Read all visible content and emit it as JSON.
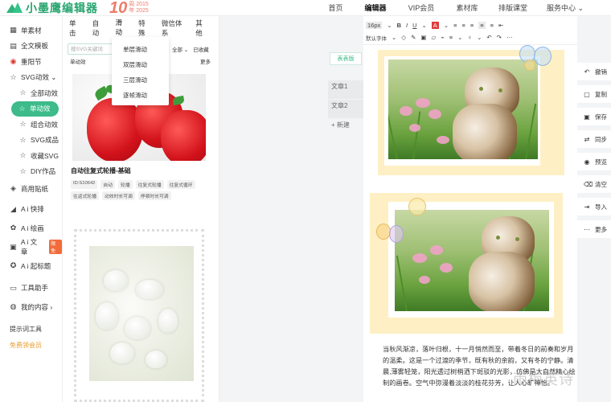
{
  "brand": {
    "name": "小墨鹰编辑器",
    "badge_num": "10",
    "badge_line1": "周 2015",
    "badge_line2": "年 2025"
  },
  "nav": [
    "首页",
    "编辑器",
    "VIP会员",
    "素材库",
    "排版课堂",
    "服务中心 ⌄"
  ],
  "sidebar": {
    "items": [
      {
        "icon": "grid-icon",
        "glyph": "▦",
        "label": "单素材"
      },
      {
        "icon": "template-icon",
        "glyph": "▤",
        "label": "全文模板"
      },
      {
        "icon": "festival-icon",
        "glyph": "◉",
        "label": "重阳节"
      },
      {
        "icon": "svg-icon",
        "glyph": "☆",
        "label": "SVG动效 ⌄"
      }
    ],
    "sub_items": [
      "全部动效",
      "单动效",
      "组合动效",
      "SVG成品",
      "收藏SVG",
      "DIY作品"
    ],
    "items2": [
      {
        "icon": "chart-icon",
        "glyph": "◈",
        "label": "商用贴纸"
      },
      {
        "icon": "ai-typeset-icon",
        "glyph": "◢",
        "label": "A i 快排"
      },
      {
        "icon": "ai-paint-icon",
        "glyph": "✿",
        "label": "A i 绘画"
      },
      {
        "icon": "ai-text-icon",
        "glyph": "▣",
        "label": "A i 文章",
        "hot": "限免"
      },
      {
        "icon": "ai-title-icon",
        "glyph": "✪",
        "label": "A i 起标题"
      },
      {
        "icon": "tool-icon",
        "glyph": "▭",
        "label": "工具助手"
      },
      {
        "icon": "user-icon",
        "glyph": "◍",
        "label": "我的内容 ›"
      }
    ],
    "footer": [
      "提示词工具",
      "免费领会员"
    ]
  },
  "panel": {
    "tabs": [
      "单击",
      "自动",
      "滑动",
      "特殊",
      "微信体系",
      "其他"
    ],
    "search_placeholder": "搜SVG关键词",
    "filter_all": "全部 ⌄",
    "filter_fav": "已收藏",
    "section_label": "单动效",
    "more": "更多",
    "item_title": "自动往复式轮播-基础",
    "tags": [
      "ID:S10642",
      "自动",
      "轮播",
      "往复式轮播",
      "往复式循环",
      "往返式轮播",
      "动效时长可调",
      "停顿时长可调"
    ]
  },
  "dropdown": [
    "单层滑动",
    "双层滑动",
    "三层滑动",
    "逐帧滑动"
  ],
  "canvas": {
    "style_button": "表表版",
    "docs": [
      "文章1",
      "文章2",
      "+ 新建"
    ],
    "toolbar_row1": [
      "16px",
      "⌄",
      "B",
      "I",
      "U",
      "⌄",
      "A",
      "⌄",
      "≡",
      "≡",
      "≡",
      "≡",
      "≡",
      "⇤"
    ],
    "toolbar_row2": [
      "默认字体",
      "⌄",
      "◇",
      "✎",
      "▣",
      "▱",
      "⌁",
      "≡",
      "⌄",
      "♀",
      "⌄",
      "↶",
      "↷",
      "⋯"
    ],
    "paragraph": "当秋风渐凉，落叶归根，十一月悄然而至，带着冬日的前奏和岁月的温柔。这是一个过渡的季节，既有秋的余韵，又有冬的宁静。清晨,薄雾轻笼，阳光透过树梢洒下斑驳的光影，仿佛是大自然精心绘制的画卷。空气中弥漫着淡淡的桂花芬芳，让人心旷神怡。"
  },
  "actions": [
    {
      "icon": "undo-icon",
      "glyph": "↶",
      "label": "撤销"
    },
    {
      "icon": "copy-icon",
      "glyph": "▢",
      "label": "复制"
    },
    {
      "icon": "save-icon",
      "glyph": "▣",
      "label": "保存"
    },
    {
      "icon": "sync-icon",
      "glyph": "⇄",
      "label": "同步"
    },
    {
      "icon": "preview-icon",
      "glyph": "◉",
      "label": "预览"
    },
    {
      "icon": "clear-icon",
      "glyph": "⌫",
      "label": "清空"
    },
    {
      "icon": "import-icon",
      "glyph": "⇥",
      "label": "导入"
    },
    {
      "icon": "more-icon",
      "glyph": "⋯",
      "label": "更多"
    }
  ],
  "watermark": "雨梅英诗",
  "colors": {
    "accent": "#3dbb8a",
    "frame": "#fef0c4",
    "brand": "#27a56f"
  }
}
